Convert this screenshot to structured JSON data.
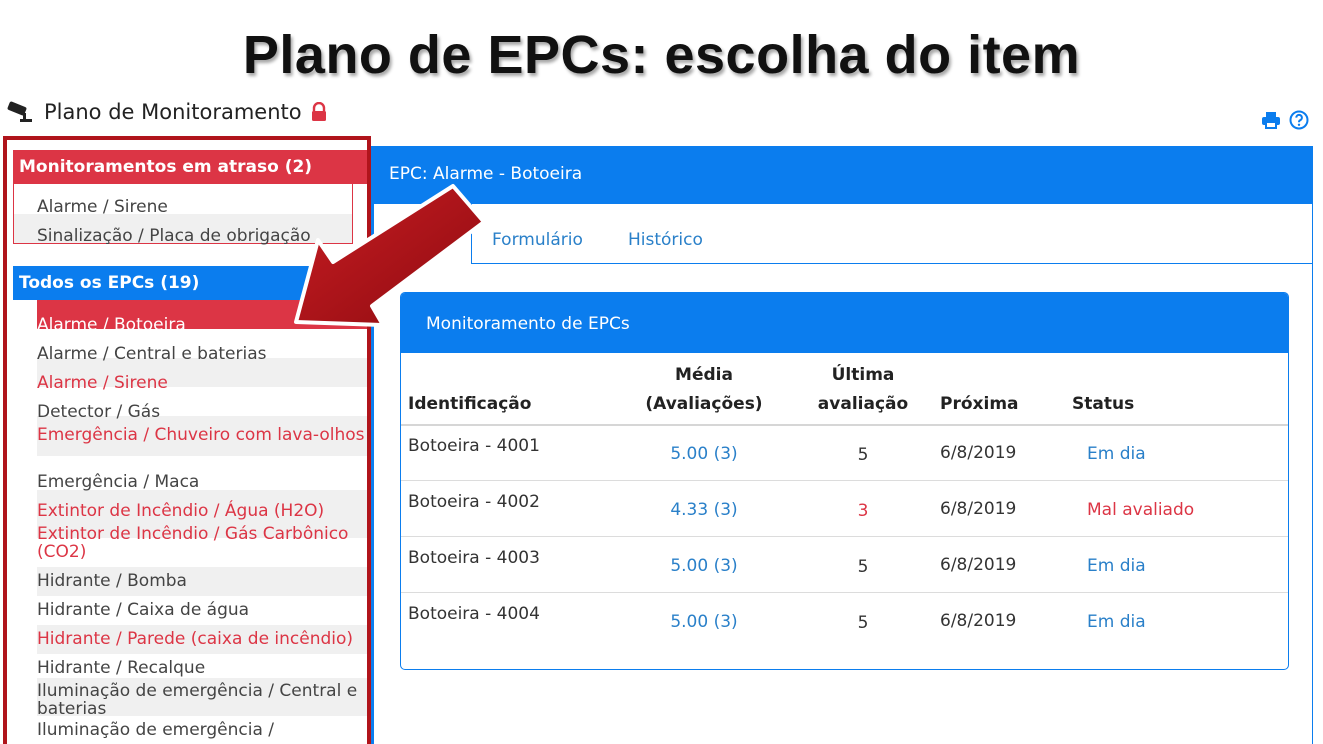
{
  "slide_title": "Plano de EPCs: escolha do item",
  "app": {
    "title": "Plano de Monitoramento",
    "icons": [
      "camera-icon",
      "lock-icon",
      "print-icon",
      "help-icon"
    ]
  },
  "sidebar": {
    "overdue_header": "Monitoramentos em atraso (2)",
    "overdue_items": [
      {
        "label": "Alarme / Sirene"
      },
      {
        "label": "Sinalização / Placa de obrigação"
      }
    ],
    "all_header": "Todos os EPCs (19)",
    "items": [
      {
        "label": "Alarme / Botoeira",
        "state": "active"
      },
      {
        "label": "Alarme / Central e baterias",
        "state": "normal"
      },
      {
        "label": "Alarme / Sirene",
        "state": "overdue"
      },
      {
        "label": "Detector / Gás",
        "state": "normal"
      },
      {
        "label": "Emergência / Chuveiro com lava-olhos",
        "state": "overdue"
      },
      {
        "label": "Emergência / Maca",
        "state": "normal"
      },
      {
        "label": "Extintor de Incêndio / Água (H2O)",
        "state": "overdue"
      },
      {
        "label": "Extintor de Incêndio / Gás Carbônico (CO2)",
        "state": "overdue"
      },
      {
        "label": "Hidrante / Bomba",
        "state": "normal"
      },
      {
        "label": "Hidrante / Caixa de água",
        "state": "normal"
      },
      {
        "label": "Hidrante / Parede (caixa de incêndio)",
        "state": "overdue"
      },
      {
        "label": "Hidrante / Recalque",
        "state": "normal"
      },
      {
        "label": "Iluminação de emergência / Central e baterias",
        "state": "normal"
      },
      {
        "label": "Iluminação de emergência /",
        "state": "normal"
      }
    ]
  },
  "main": {
    "panel_title": "EPC: Alarme - Botoeira",
    "tabs": [
      {
        "label": "Formulário"
      },
      {
        "label": "Histórico"
      }
    ],
    "card_title": "Monitoramento de EPCs",
    "columns": {
      "id": "Identificação",
      "media_1": "Média",
      "media_2": "(Avaliações)",
      "ultima_1": "Última",
      "ultima_2": "avaliação",
      "proxima": "Próxima",
      "status": "Status"
    },
    "rows": [
      {
        "id": "Botoeira - 4001",
        "media": "5.00 (3)",
        "ultima": "5",
        "proxima": "6/8/2019",
        "status": "Em dia"
      },
      {
        "id": "Botoeira - 4002",
        "media": "4.33 (3)",
        "ultima": "3",
        "proxima": "6/8/2019",
        "status": "Mal avaliado"
      },
      {
        "id": "Botoeira - 4003",
        "media": "5.00 (3)",
        "ultima": "5",
        "proxima": "6/8/2019",
        "status": "Em dia"
      },
      {
        "id": "Botoeira - 4004",
        "media": "5.00 (3)",
        "ultima": "5",
        "proxima": "6/8/2019",
        "status": "Em dia"
      }
    ]
  },
  "colors": {
    "brand_blue": "#0b7dee",
    "alert_red": "#dc3545",
    "highlight_border": "#b0141b",
    "link_blue": "#2a80c9"
  }
}
